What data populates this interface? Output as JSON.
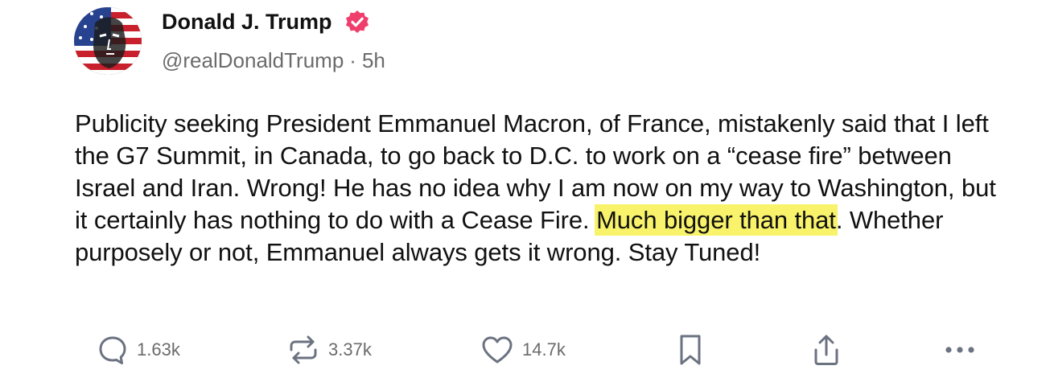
{
  "author": {
    "name": "Donald J. Trump",
    "handle": "@realDonaldTrump",
    "separator": "·",
    "time": "5h",
    "verified_color": "#ef3e6b",
    "avatar_icon": "avatar-flag-portrait"
  },
  "post": {
    "text_before_highlight": "Publicity seeking President Emmanuel Macron, of France, mistakenly said that I left the G7 Summit, in Canada, to go back to D.C. to work on a “cease fire” between Israel and Iran. Wrong! He has no idea why I am now on my way to Washington, but it certainly has nothing to do with a Cease Fire. ",
    "highlight": "Much bigger than that",
    "text_after_highlight": ". Whether purposely or not, Emmanuel always gets it wrong. Stay Tuned!",
    "highlight_color": "#f8f36a"
  },
  "actions": {
    "replies": {
      "icon": "reply-bubble-icon",
      "count": "1.63k"
    },
    "retruths": {
      "icon": "retruth-icon",
      "count": "3.37k"
    },
    "likes": {
      "icon": "heart-icon",
      "count": "14.7k"
    },
    "bookmark": {
      "icon": "bookmark-icon"
    },
    "share": {
      "icon": "share-icon"
    },
    "more": {
      "icon": "more-dots-icon"
    }
  }
}
